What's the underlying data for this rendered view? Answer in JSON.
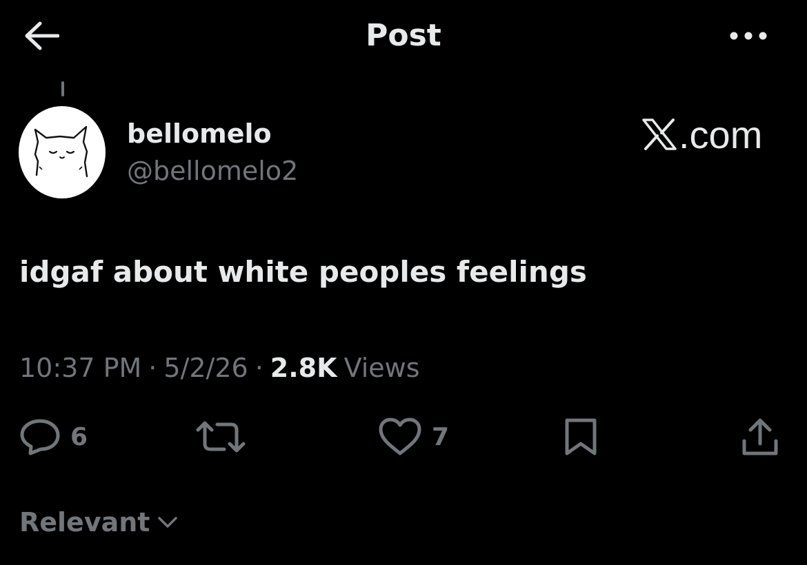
{
  "header": {
    "title": "Post",
    "back_icon": "arrow-left-icon",
    "more_icon": "more-horizontal-icon"
  },
  "post": {
    "author": {
      "display_name": "bellomelo",
      "handle": "@bellomelo2"
    },
    "brand_watermark": ".com",
    "brand_watermark_full": "X.com",
    "text": "idgaf about white peoples feelings",
    "time": "10:37 PM",
    "date": "5/2/26",
    "views_count": "2.8K",
    "views_label": "Views",
    "separator": "·"
  },
  "actions": {
    "reply_count": "6",
    "repost_count": "",
    "like_count": "7"
  },
  "replies_sort": {
    "label": "Relevant"
  },
  "colors": {
    "background": "#000000",
    "primary_text": "#e7e9ea",
    "secondary_text": "#71767b"
  }
}
